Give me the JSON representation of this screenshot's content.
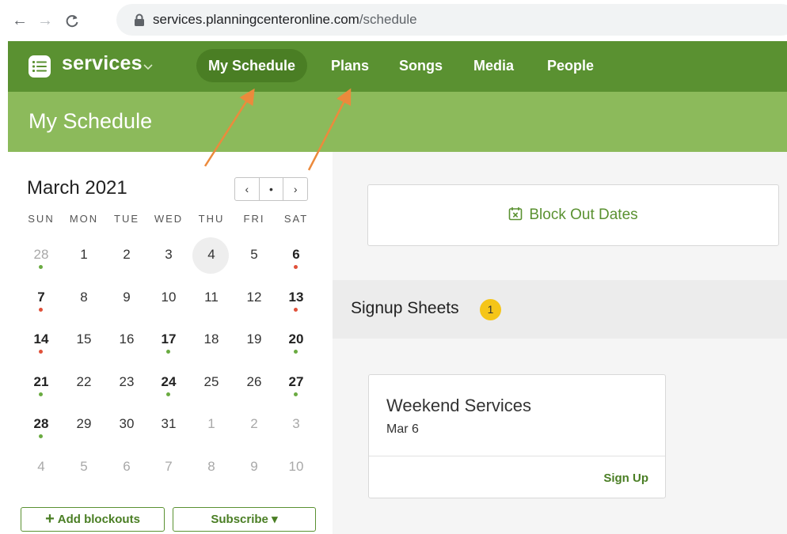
{
  "browser": {
    "url_domain": "services.planningcenteronline.com",
    "url_path": "/schedule",
    "back_glyph": "←",
    "forward_glyph": "→",
    "reload_glyph": "C"
  },
  "app": {
    "brand": "services",
    "nav": [
      "My Schedule",
      "Plans",
      "Songs",
      "Media",
      "People"
    ],
    "active_nav": "My Schedule",
    "page_title": "My Schedule"
  },
  "calendar": {
    "month": "March",
    "year": "2021",
    "prev_glyph": "‹",
    "today_glyph": "•",
    "next_glyph": "›",
    "weekdays": [
      "SUN",
      "MON",
      "TUE",
      "WED",
      "THU",
      "FRI",
      "SAT"
    ],
    "weeks": [
      [
        {
          "d": "28",
          "m": 1,
          "dot": "green"
        },
        {
          "d": "1"
        },
        {
          "d": "2"
        },
        {
          "d": "3"
        },
        {
          "d": "4",
          "today": 1
        },
        {
          "d": "5"
        },
        {
          "d": "6",
          "b": 1,
          "dot": "red"
        }
      ],
      [
        {
          "d": "7",
          "b": 1,
          "dot": "red"
        },
        {
          "d": "8"
        },
        {
          "d": "9"
        },
        {
          "d": "10"
        },
        {
          "d": "11"
        },
        {
          "d": "12"
        },
        {
          "d": "13",
          "b": 1,
          "dot": "red"
        }
      ],
      [
        {
          "d": "14",
          "b": 1,
          "dot": "red"
        },
        {
          "d": "15"
        },
        {
          "d": "16"
        },
        {
          "d": "17",
          "b": 1,
          "dot": "green"
        },
        {
          "d": "18"
        },
        {
          "d": "19"
        },
        {
          "d": "20",
          "b": 1,
          "dot": "green"
        }
      ],
      [
        {
          "d": "21",
          "b": 1,
          "dot": "green"
        },
        {
          "d": "22"
        },
        {
          "d": "23"
        },
        {
          "d": "24",
          "b": 1,
          "dot": "green"
        },
        {
          "d": "25"
        },
        {
          "d": "26"
        },
        {
          "d": "27",
          "b": 1,
          "dot": "green"
        }
      ],
      [
        {
          "d": "28",
          "b": 1,
          "dot": "green"
        },
        {
          "d": "29"
        },
        {
          "d": "30"
        },
        {
          "d": "31"
        },
        {
          "d": "1",
          "m": 1
        },
        {
          "d": "2",
          "m": 1
        },
        {
          "d": "3",
          "m": 1
        }
      ],
      [
        {
          "d": "4",
          "m": 1
        },
        {
          "d": "5",
          "m": 1
        },
        {
          "d": "6",
          "m": 1
        },
        {
          "d": "7",
          "m": 1
        },
        {
          "d": "8",
          "m": 1
        },
        {
          "d": "9",
          "m": 1
        },
        {
          "d": "10",
          "m": 1
        }
      ]
    ],
    "add_blockouts_plus": "+",
    "add_blockouts_label": "Add blockouts",
    "subscribe_label": "Subscribe ▾"
  },
  "blockout": {
    "label": "Block Out Dates"
  },
  "signup": {
    "title": "Signup Sheets",
    "badge": "1",
    "event_title": "Weekend Services",
    "event_date": "Mar 6",
    "action": "Sign Up"
  },
  "colors": {
    "nav_green": "#5a9131",
    "nav_active": "#4a7e24",
    "header_green": "#8cba5b",
    "dot_green": "#6aab41",
    "dot_red": "#e0513a",
    "badge_yellow": "#f5c518",
    "arrow_orange": "#ec8a3c"
  }
}
